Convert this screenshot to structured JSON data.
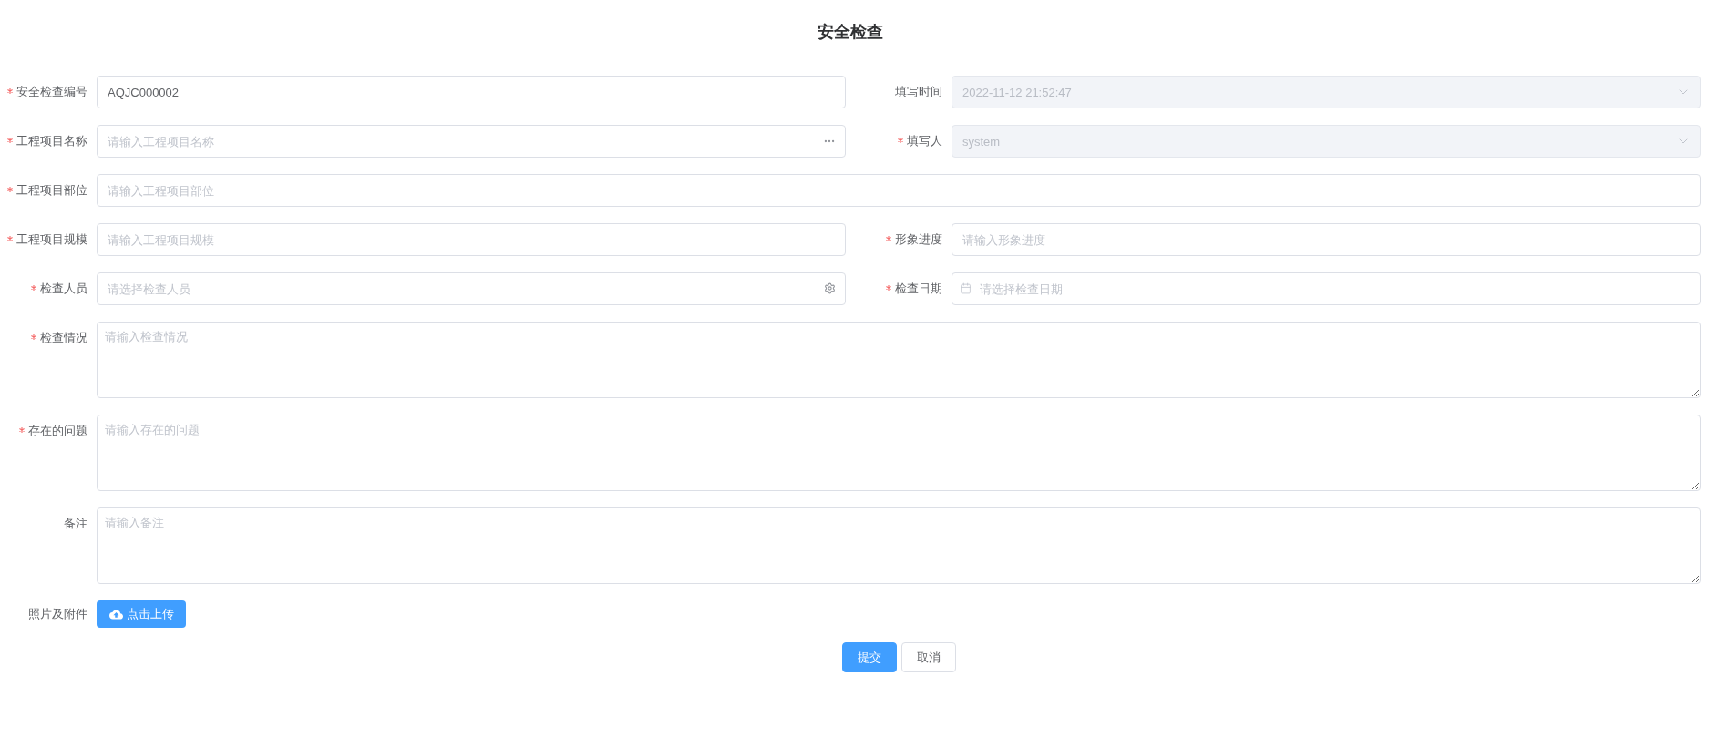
{
  "title": "安全检查",
  "rows": [
    [
      {
        "label": "安全检查编号",
        "required": true,
        "kind": "text",
        "value": "AQJC000002",
        "disabled": false
      },
      {
        "label": "填写时间",
        "required": false,
        "kind": "select",
        "value": "2022-11-12 21:52:47",
        "disabled": true
      }
    ],
    [
      {
        "label": "工程项目名称",
        "required": true,
        "kind": "more",
        "placeholder": "请输入工程项目名称",
        "disabled": false
      },
      {
        "label": "填写人",
        "required": true,
        "kind": "select",
        "value": "system",
        "disabled": true
      }
    ],
    [
      {
        "label": "工程项目部位",
        "required": true,
        "kind": "text",
        "placeholder": "请输入工程项目部位",
        "disabled": false
      }
    ],
    [
      {
        "label": "工程项目规模",
        "required": true,
        "kind": "text",
        "placeholder": "请输入工程项目规模",
        "disabled": false
      },
      {
        "label": "形象进度",
        "required": true,
        "kind": "text",
        "placeholder": "请输入形象进度",
        "disabled": false
      }
    ],
    [
      {
        "label": "检查人员",
        "required": true,
        "kind": "picker",
        "placeholder": "请选择检查人员",
        "disabled": false
      },
      {
        "label": "检查日期",
        "required": true,
        "kind": "date",
        "placeholder": "请选择检查日期",
        "disabled": false
      }
    ],
    [
      {
        "label": "检查情况",
        "required": true,
        "kind": "textarea",
        "placeholder": "请输入检查情况",
        "disabled": false
      }
    ],
    [
      {
        "label": "存在的问题",
        "required": true,
        "kind": "textarea",
        "placeholder": "请输入存在的问题",
        "disabled": false
      }
    ],
    [
      {
        "label": "备注",
        "required": false,
        "kind": "textarea",
        "placeholder": "请输入备注",
        "disabled": false
      }
    ]
  ],
  "upload": {
    "label": "照片及附件",
    "button": "点击上传"
  },
  "actions": [
    {
      "label": "提交",
      "kind": "primary"
    },
    {
      "label": "取消",
      "kind": "default"
    }
  ]
}
